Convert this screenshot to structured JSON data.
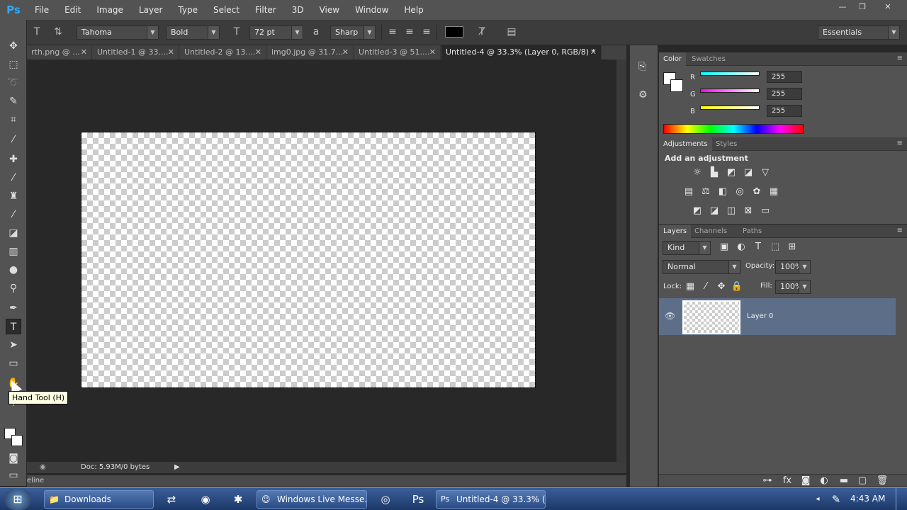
{
  "app": {
    "logo": "Ps"
  },
  "menu": [
    "File",
    "Edit",
    "Image",
    "Layer",
    "Type",
    "Select",
    "Filter",
    "3D",
    "View",
    "Window",
    "Help"
  ],
  "window_controls": {
    "min": "—",
    "max": "❐",
    "close": "✕"
  },
  "options": {
    "font_family": "Tahoma",
    "font_style": "Bold",
    "font_size": "72 pt",
    "antialias": "Sharp",
    "workspace": "Essentials",
    "text_color": "#000000"
  },
  "tabs": [
    {
      "label": "rth.png @ ..."
    },
    {
      "label": "Untitled-1 @ 33...."
    },
    {
      "label": "Untitled-2 @ 13...."
    },
    {
      "label": "img0.jpg @ 31.7..."
    },
    {
      "label": "Untitled-3 @ 51...."
    },
    {
      "label": "Untitled-4 @ 33.3% (Layer 0, RGB/8) *",
      "active": true
    }
  ],
  "status": {
    "doc": "Doc: 5.93M/0 bytes",
    "timeline_label": "eline"
  },
  "tooltip": "Hand Tool (H)",
  "color_panel": {
    "tabs": [
      "Color",
      "Swatches"
    ],
    "channels": [
      {
        "label": "R",
        "value": "255",
        "color": "#00ffff"
      },
      {
        "label": "G",
        "value": "255",
        "color": "#ff00ff"
      },
      {
        "label": "B",
        "value": "255",
        "color": "#ffff00"
      }
    ]
  },
  "adjustments_panel": {
    "tabs": [
      "Adjustments",
      "Styles"
    ],
    "heading": "Add an adjustment"
  },
  "layers_panel": {
    "tabs": [
      "Layers",
      "Channels",
      "Paths"
    ],
    "kind": "Kind",
    "blend_mode": "Normal",
    "opacity_label": "Opacity:",
    "opacity": "100%",
    "lock_label": "Lock:",
    "fill_label": "Fill:",
    "fill": "100%",
    "layers": [
      {
        "name": "Layer 0",
        "visible": true
      }
    ]
  },
  "taskbar": {
    "buttons": [
      "Downloads",
      "Windows Live Messe...",
      "Untitled-4 @ 33.3% (..."
    ],
    "time": "4:43 AM"
  },
  "colors": {
    "accent": "#31a8ff",
    "selected_layer": "#5d6f88"
  }
}
